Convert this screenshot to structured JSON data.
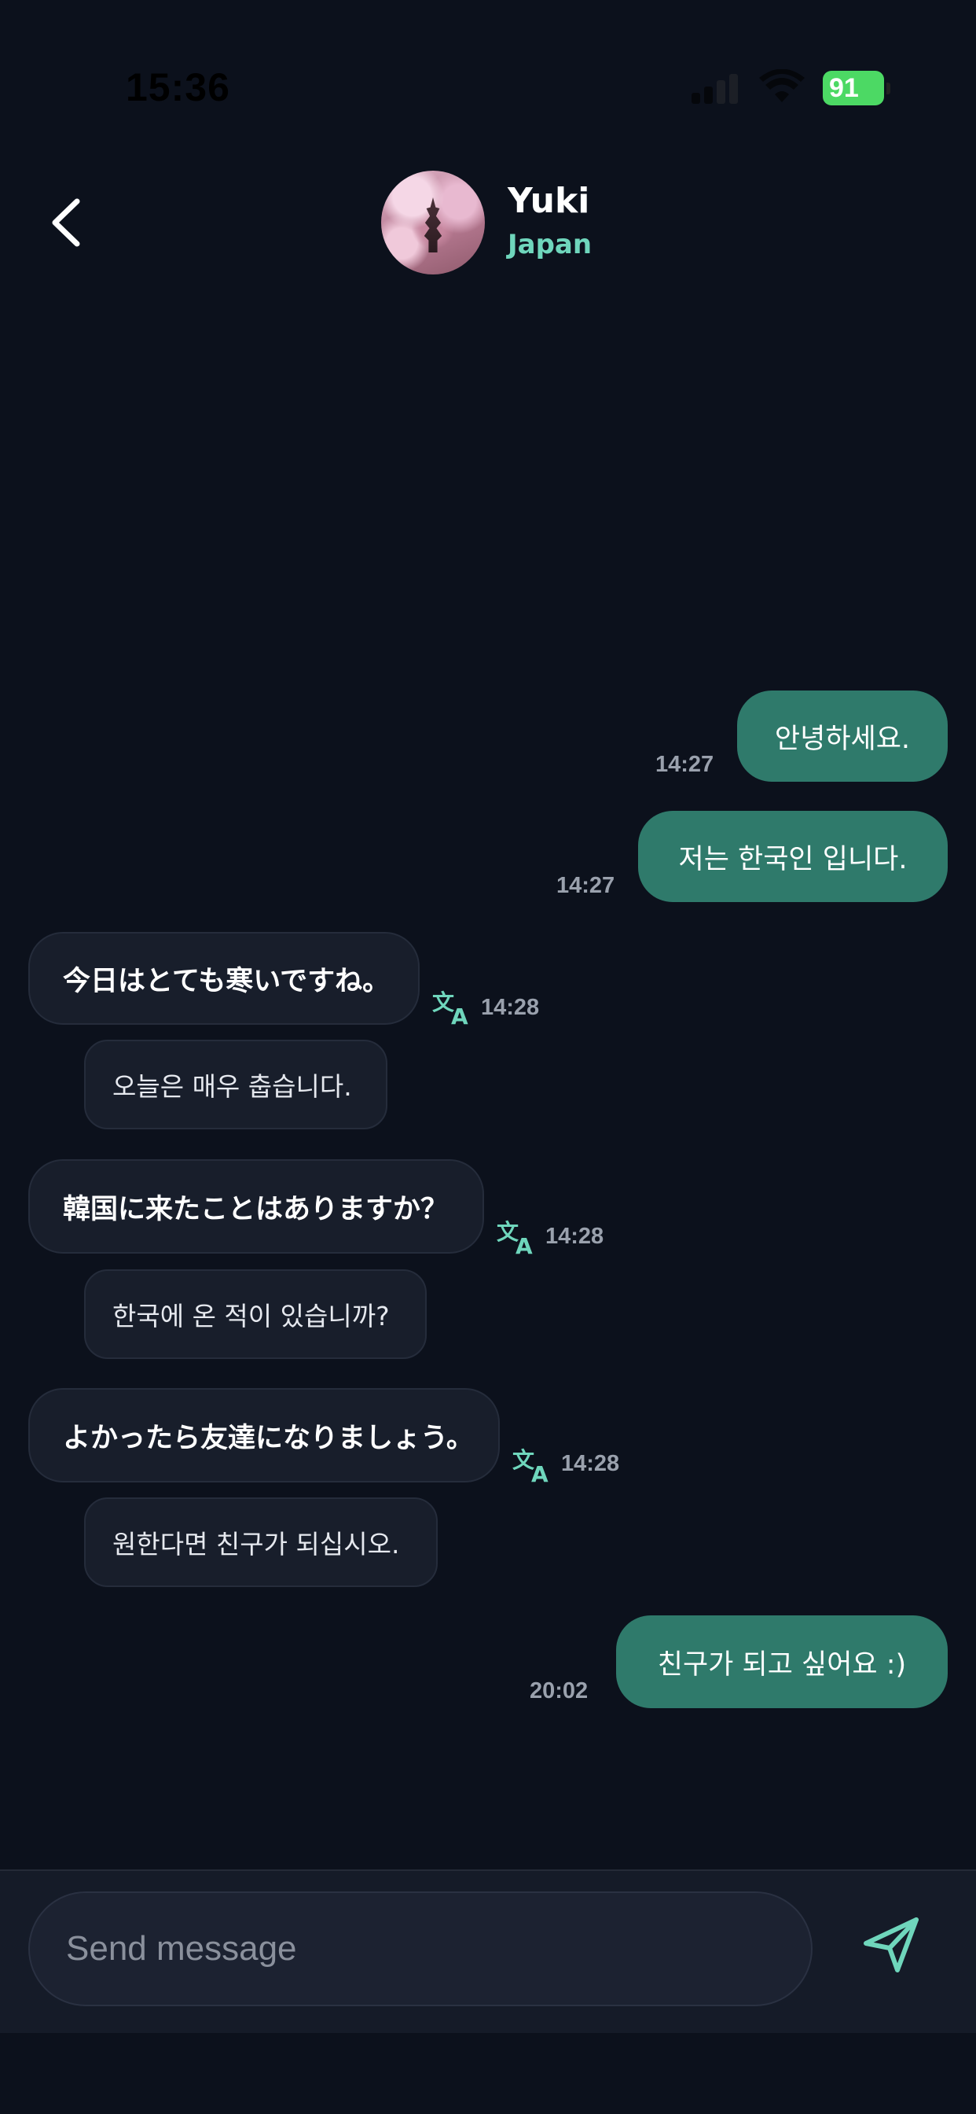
{
  "status_bar": {
    "time": "15:36",
    "battery": "91"
  },
  "header": {
    "contact_name": "Yuki",
    "contact_country": "Japan"
  },
  "messages": [
    {
      "direction": "out",
      "text": "안녕하세요.",
      "time": "14:27"
    },
    {
      "direction": "out",
      "text": "저는 한국인 입니다.",
      "time": "14:27"
    },
    {
      "direction": "in",
      "text": "今日はとても寒いですね。",
      "translation": "오늘은 매우 춥습니다.",
      "time": "14:28"
    },
    {
      "direction": "in",
      "text": "韓国に来たことはありますか？",
      "translation": "한국에 온 적이 있습니까?",
      "time": "14:28"
    },
    {
      "direction": "in",
      "text": "よかったら友達になりましょう。",
      "translation": "원한다면 친구가 되십시오.",
      "time": "14:28"
    },
    {
      "direction": "out",
      "text": "친구가 되고 싶어요 :)",
      "time": "20:02"
    }
  ],
  "composer": {
    "placeholder": "Send message"
  },
  "colors": {
    "background": "#0c111c",
    "outgoing_bubble": "#2f7a6b",
    "incoming_bubble": "#181e2b",
    "accent": "#6fd6bc"
  }
}
